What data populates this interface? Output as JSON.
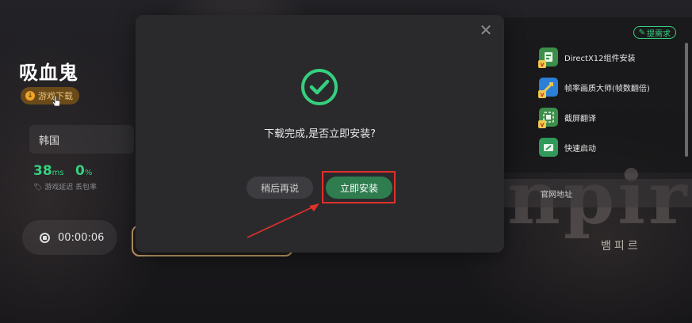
{
  "game": {
    "title": "吸血鬼",
    "download_chip": "游戏下载",
    "region": "韩国",
    "latency_value": "38",
    "latency_unit": "ms",
    "latency_label": "游戏延迟",
    "loss_value": "0",
    "loss_unit": "%",
    "loss_label": "丢包率",
    "timer": "00:00:06"
  },
  "tools": {
    "request_badge": "提需求",
    "items": [
      {
        "label": "DirectX12组件安装",
        "icon": "directx-icon",
        "color": "#3b8f4a"
      },
      {
        "label": "帧率画质大师(帧数翻倍)",
        "icon": "frame-rate-icon",
        "color": "#2c7fd6"
      },
      {
        "label": "截屏翻译",
        "icon": "screenshot-translate-icon",
        "color": "#3b8f4a"
      },
      {
        "label": "快速启动",
        "icon": "quick-launch-icon",
        "color": "#2f9a5a"
      }
    ],
    "site_label": "官网地址"
  },
  "backdrop": {
    "letters": "npire",
    "korean": "뱀피르"
  },
  "modal": {
    "message": "下载完成,是否立即安装?",
    "later_label": "稍后再说",
    "install_label": "立即安装"
  },
  "colors": {
    "accent_green": "#35d07f",
    "install_green": "#2f7d4f",
    "highlight_red": "#e0302a"
  }
}
